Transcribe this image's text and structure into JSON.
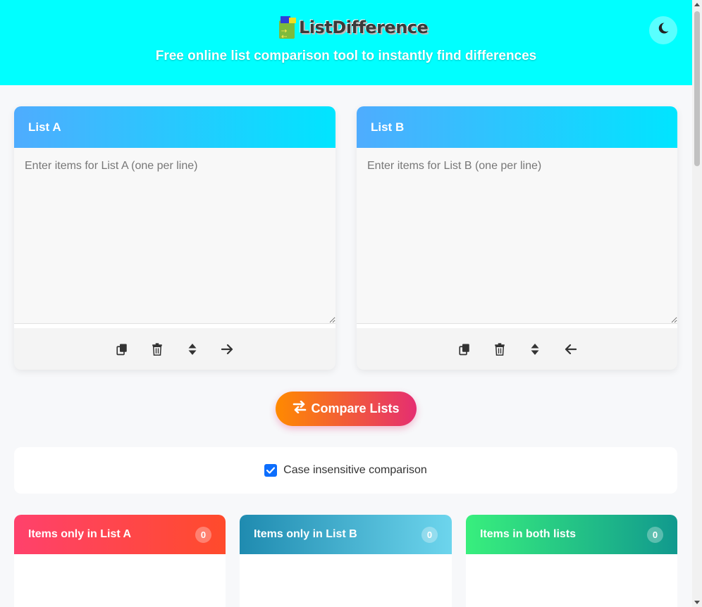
{
  "header": {
    "logo_text": "ListDifference",
    "tagline": "Free online list comparison tool to instantly find differences",
    "theme_icon": "moon-icon"
  },
  "list_a": {
    "title": "List A",
    "placeholder": "Enter items for List A (one per line)",
    "value": "",
    "tools": [
      "copy-icon",
      "trash-icon",
      "sort-icon",
      "arrow-right-icon"
    ]
  },
  "list_b": {
    "title": "List B",
    "placeholder": "Enter items for List B (one per line)",
    "value": "",
    "tools": [
      "copy-icon",
      "trash-icon",
      "sort-icon",
      "arrow-left-icon"
    ]
  },
  "compare_button": {
    "label": "Compare Lists",
    "icon": "exchange-icon"
  },
  "options": {
    "case_insensitive_label": "Case insensitive comparison",
    "case_insensitive_checked": true
  },
  "results": {
    "only_a": {
      "title": "Items only in List A",
      "count": "0"
    },
    "only_b": {
      "title": "Items only in List B",
      "count": "0"
    },
    "both": {
      "title": "Items in both lists",
      "count": "0"
    }
  },
  "colors": {
    "header_bg": "#00ffff",
    "compare_start": "#ff8a00",
    "compare_end": "#e52e71",
    "checkbox": "#0d6efd"
  }
}
